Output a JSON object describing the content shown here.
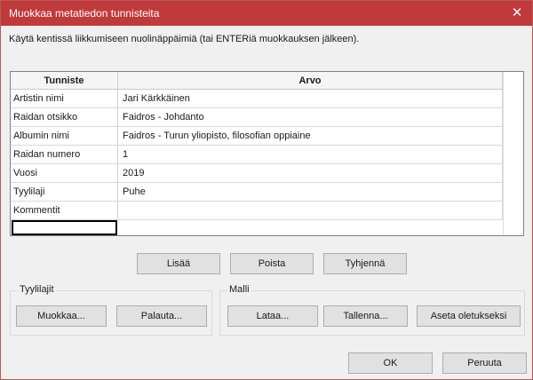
{
  "window": {
    "title": "Muokkaa metatiedon tunnisteita",
    "close_glyph": "✕"
  },
  "hint": "Käytä kentissä liikkumiseen nuolinäppäimiä (tai ENTERiä muokkauksen jälkeen).",
  "table": {
    "headers": [
      "Tunniste",
      "Arvo"
    ],
    "rows": [
      [
        "Artistin nimi",
        "Jari Kärkkäinen"
      ],
      [
        "Raidan otsikko",
        "Faidros - Johdanto"
      ],
      [
        "Albumin nimi",
        "Faidros - Turun yliopisto, filosofian oppiaine"
      ],
      [
        "Raidan numero",
        "1"
      ],
      [
        "Vuosi",
        "2019"
      ],
      [
        "Tyylilaji",
        "Puhe"
      ],
      [
        "Kommentit",
        ""
      ]
    ]
  },
  "buttons": {
    "add": "Lisää",
    "remove": "Poista",
    "clear": "Tyhjennä",
    "edit": "Muokkaa...",
    "restore": "Palauta...",
    "load": "Lataa...",
    "save": "Tallenna...",
    "set_default": "Aseta oletukseksi",
    "ok": "OK",
    "cancel": "Peruuta"
  },
  "groups": {
    "genres": "Tyylilajit",
    "template": "Malli"
  }
}
